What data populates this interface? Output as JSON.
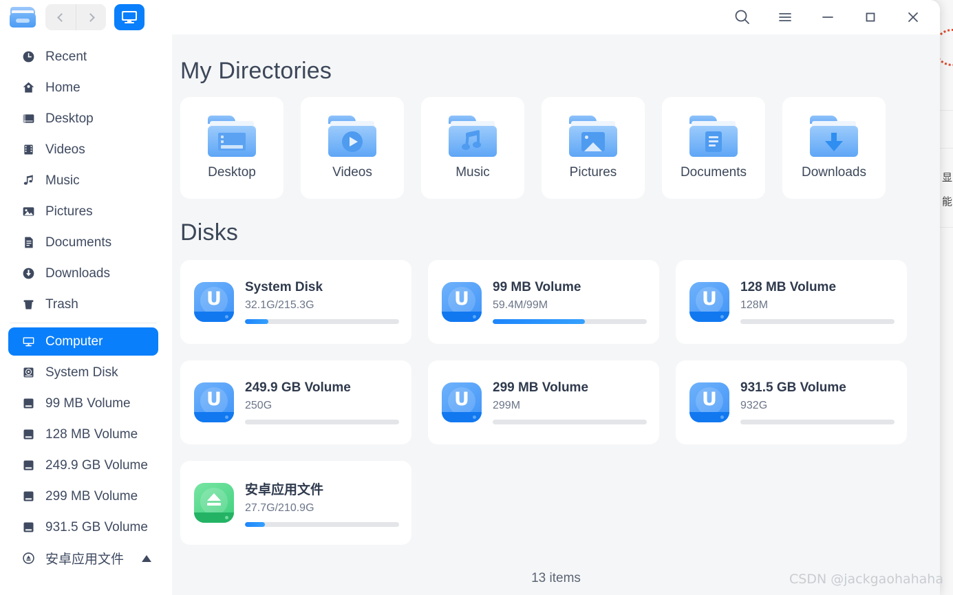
{
  "titlebar": {
    "app_icon": "folder-app-icon",
    "back_label": "Back",
    "forward_label": "Forward",
    "crumb_label": "Computer",
    "search_label": "Search",
    "menu_label": "Menu",
    "minimize_label": "Minimize",
    "maximize_label": "Maximize",
    "close_label": "Close"
  },
  "sidebar": {
    "items": [
      {
        "label": "Recent",
        "icon": "clock-icon",
        "selected": false
      },
      {
        "label": "Home",
        "icon": "home-icon",
        "selected": false
      },
      {
        "label": "Desktop",
        "icon": "desktop-icon",
        "selected": false
      },
      {
        "label": "Videos",
        "icon": "film-icon",
        "selected": false
      },
      {
        "label": "Music",
        "icon": "note-icon",
        "selected": false
      },
      {
        "label": "Pictures",
        "icon": "image-icon",
        "selected": false
      },
      {
        "label": "Documents",
        "icon": "document-icon",
        "selected": false
      },
      {
        "label": "Downloads",
        "icon": "download-icon",
        "selected": false
      },
      {
        "label": "Trash",
        "icon": "trash-icon",
        "selected": false
      },
      {
        "label": "Computer",
        "icon": "monitor-icon",
        "selected": true
      },
      {
        "label": "System Disk",
        "icon": "harddisk-icon",
        "selected": false
      },
      {
        "label": "99 MB Volume",
        "icon": "drive-icon",
        "selected": false
      },
      {
        "label": "128 MB Volume",
        "icon": "drive-icon",
        "selected": false
      },
      {
        "label": "249.9 GB Volume",
        "icon": "drive-icon",
        "selected": false
      },
      {
        "label": "299 MB Volume",
        "icon": "drive-icon",
        "selected": false
      },
      {
        "label": "931.5 GB Volume",
        "icon": "drive-icon",
        "selected": false
      },
      {
        "label": "安卓应用文件",
        "icon": "android-icon",
        "selected": false,
        "eject": true
      }
    ],
    "separator_after_index": 8
  },
  "main": {
    "directories_title": "My Directories",
    "directories": [
      {
        "label": "Desktop",
        "icon": "folder-desktop-icon"
      },
      {
        "label": "Videos",
        "icon": "folder-videos-icon"
      },
      {
        "label": "Music",
        "icon": "folder-music-icon"
      },
      {
        "label": "Pictures",
        "icon": "folder-pictures-icon"
      },
      {
        "label": "Documents",
        "icon": "folder-documents-icon"
      },
      {
        "label": "Downloads",
        "icon": "folder-downloads-icon"
      }
    ],
    "disks_title": "Disks",
    "disks": [
      {
        "name": "System Disk",
        "size": "32.1G/215.3G",
        "percent": 15,
        "icon": "uos-disk-icon",
        "color": "blue"
      },
      {
        "name": "99 MB Volume",
        "size": "59.4M/99M",
        "percent": 60,
        "icon": "uos-disk-icon",
        "color": "blue"
      },
      {
        "name": "128 MB Volume",
        "size": "128M",
        "percent": 0,
        "icon": "uos-disk-icon",
        "color": "blue"
      },
      {
        "name": "249.9 GB Volume",
        "size": "250G",
        "percent": 0,
        "icon": "uos-disk-icon",
        "color": "blue"
      },
      {
        "name": "299 MB Volume",
        "size": "299M",
        "percent": 0,
        "icon": "uos-disk-icon",
        "color": "blue"
      },
      {
        "name": "931.5 GB Volume",
        "size": "932G",
        "percent": 0,
        "icon": "uos-disk-icon",
        "color": "blue"
      },
      {
        "name": "安卓应用文件",
        "size": "27.7G/210.9G",
        "percent": 13,
        "icon": "android-eject-icon",
        "color": "green"
      }
    ]
  },
  "footer": {
    "item_count": "13 items"
  },
  "watermark": {
    "text": "CSDN @jackgaohahaha"
  },
  "background": {
    "cjk_text_1": "显",
    "cjk_text_2": "能"
  },
  "colors": {
    "accent": "#0a7ffb",
    "sidebar_bg": "#ffffff",
    "content_bg": "#f5f6f7",
    "card_bg": "#ffffff",
    "text_primary": "#3c4759",
    "text_secondary": "#6b7588",
    "bar_track": "#e3e5e8",
    "bar_fill": "#1e86fb",
    "green_accent": "#3ed07e"
  }
}
